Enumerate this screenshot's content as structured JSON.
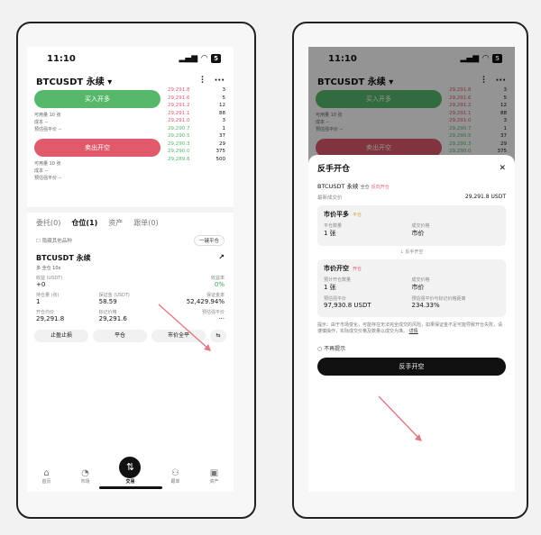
{
  "status": {
    "time": "11:10",
    "battery": "5"
  },
  "left": {
    "symbol": "BTCUSDT 永续",
    "buy_label": "买入开多",
    "sell_label": "卖出开空",
    "qty_label": "可用量 10 张",
    "cost_label": "成本 --",
    "liq_label": "预估强平价 --",
    "orderbook_top": [
      [
        "29,291.8",
        "3"
      ],
      [
        "29,291.6",
        "5"
      ],
      [
        "29,291.2",
        "12"
      ],
      [
        "29,291.1",
        "88"
      ],
      [
        "29,291.0",
        "3"
      ],
      [
        "29,290.7",
        "1"
      ],
      [
        "29,290.5",
        "37"
      ],
      [
        "29,290.3",
        "29"
      ],
      [
        "29,290.0",
        "375"
      ],
      [
        "29,289.8",
        "500"
      ]
    ],
    "tabs": [
      "委托(0)",
      "仓位(1)",
      "资产",
      "跟单(0)"
    ],
    "hide_other": "隐藏其他品种",
    "close_all": "一键平仓",
    "pos_title": "BTCUSDT 永续",
    "pos_tag": "多 全仓 10x",
    "labels": [
      "收益 (USDT)",
      "收益率",
      "持仓量 (张)",
      "保证金 (USDT)",
      "保证金率",
      "开仓均价",
      "预估强平价",
      "标记价格"
    ],
    "values": [
      "+0",
      "0%",
      "1",
      "58.59",
      "52,429.94%",
      "29,291.8",
      "29,291.6"
    ],
    "actions": [
      "止盈止损",
      "平仓",
      "市价全平",
      "⇆"
    ],
    "nav": [
      "首页",
      "市场",
      "交易",
      "跟单",
      "资产"
    ]
  },
  "right": {
    "sheet_title": "反手开仓",
    "symbol": "BTCUSDT 永续",
    "cross": "全仓",
    "reverse_tag": "反向开仓",
    "latest_label": "最新成交价",
    "latest_value": "29,291.8 USDT",
    "card1_title": "市价平多",
    "card1_badge": "平仓",
    "card1_l1": "平仓数量",
    "card1_l2": "成交价格",
    "card1_v1": "1 张",
    "card1_v2": "市价",
    "swap_text": "↓ 反手开空",
    "card2_title": "市价开空",
    "card2_badge": "开仓",
    "card2_l1": "预计开仓数量",
    "card2_l2": "成交价格",
    "card2_v1": "1 张",
    "card2_v2": "市价",
    "card2_l3": "预估强平价",
    "card2_l4": "预估强平价与标记价格距离",
    "card2_v3": "97,930.8 USDT",
    "card2_v4": "234.33%",
    "tip": "提示：由于市场变化，可能存在无法完全成交的风险，如果保证金不足可能导致开仓失败，请谨慎操作，实际成交价格及数量以成交为准。",
    "more": "详情",
    "dont_show": "不再提示",
    "confirm": "反手开空"
  }
}
